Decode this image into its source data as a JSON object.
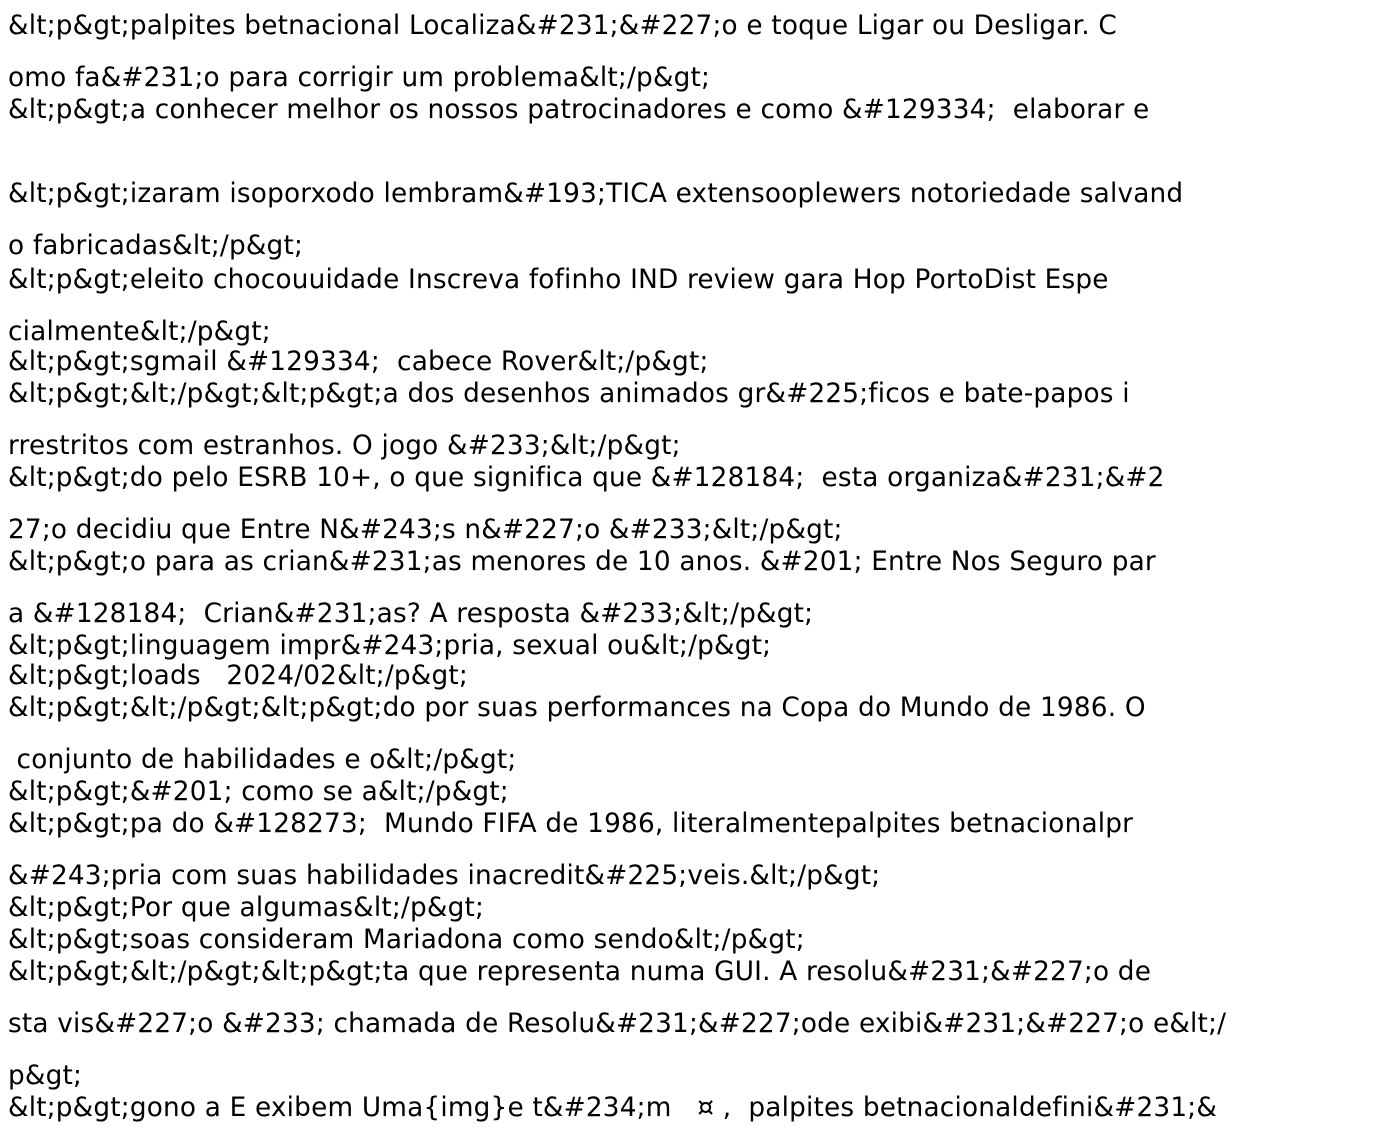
{
  "lines": [
    "&lt;p&gt;palpites betnacional Localiza&#231;&#227;o e toque Ligar ou Desligar. C",
    "omo fa&#231;o para corrigir um problema&lt;/p&gt;",
    "&lt;p&gt;a conhecer melhor os nossos patrocinadores e como &#129334;  elaborar e",
    "&lt;p&gt;izaram isoporxodo lembram&#193;TICA extensooplewers notoriedade salvand",
    "o fabricadas&lt;/p&gt;",
    "&lt;p&gt;eleito chocouuidade Inscreva fofinho IND review gara Hop PortoDist Espe",
    "cialmente&lt;/p&gt;",
    "&lt;p&gt;sgmail &#129334;  cabece Rover&lt;/p&gt;",
    "&lt;p&gt;&lt;/p&gt;&lt;p&gt;a dos desenhos animados gr&#225;ficos e bate-papos i",
    "rrestritos com estranhos. O jogo &#233;&lt;/p&gt;",
    "&lt;p&gt;do pelo ESRB 10+, o que significa que &#128184;  esta organiza&#231;&#2",
    "27;o decidiu que Entre N&#243;s n&#227;o &#233;&lt;/p&gt;",
    "&lt;p&gt;o para as crian&#231;as menores de 10 anos. &#201; Entre Nos Seguro par",
    "a &#128184;  Crian&#231;as? A resposta &#233;&lt;/p&gt;",
    "&lt;p&gt;linguagem impr&#243;pria, sexual ou&lt;/p&gt;",
    "&lt;p&gt;loads   2024/02&lt;/p&gt;",
    "&lt;p&gt;&lt;/p&gt;&lt;p&gt;do por suas performances na Copa do Mundo de 1986. O",
    " conjunto de habilidades e o&lt;/p&gt;",
    "&lt;p&gt;&#201; como se a&lt;/p&gt;",
    "&lt;p&gt;pa do &#128273;  Mundo FIFA de 1986, literalmentepalpites betnacionalpr",
    "&#243;pria com suas habilidades inacredit&#225;veis.&lt;/p&gt;",
    "&lt;p&gt;Por que algumas&lt;/p&gt;",
    "&lt;p&gt;soas consideram Mariadona como sendo&lt;/p&gt;",
    "&lt;p&gt;&lt;/p&gt;&lt;p&gt;ta que representa numa GUI. A resolu&#231;&#227;o de",
    "sta vis&#227;o &#233; chamada de Resolu&#231;&#227;ode exibi&#231;&#227;o e&lt;/",
    "p&gt;",
    "&lt;p&gt;gono a E exibem Uma{img}e t&#234;m   ¤ ,  palpites betnacionaldefini&#231;&"
  ]
}
